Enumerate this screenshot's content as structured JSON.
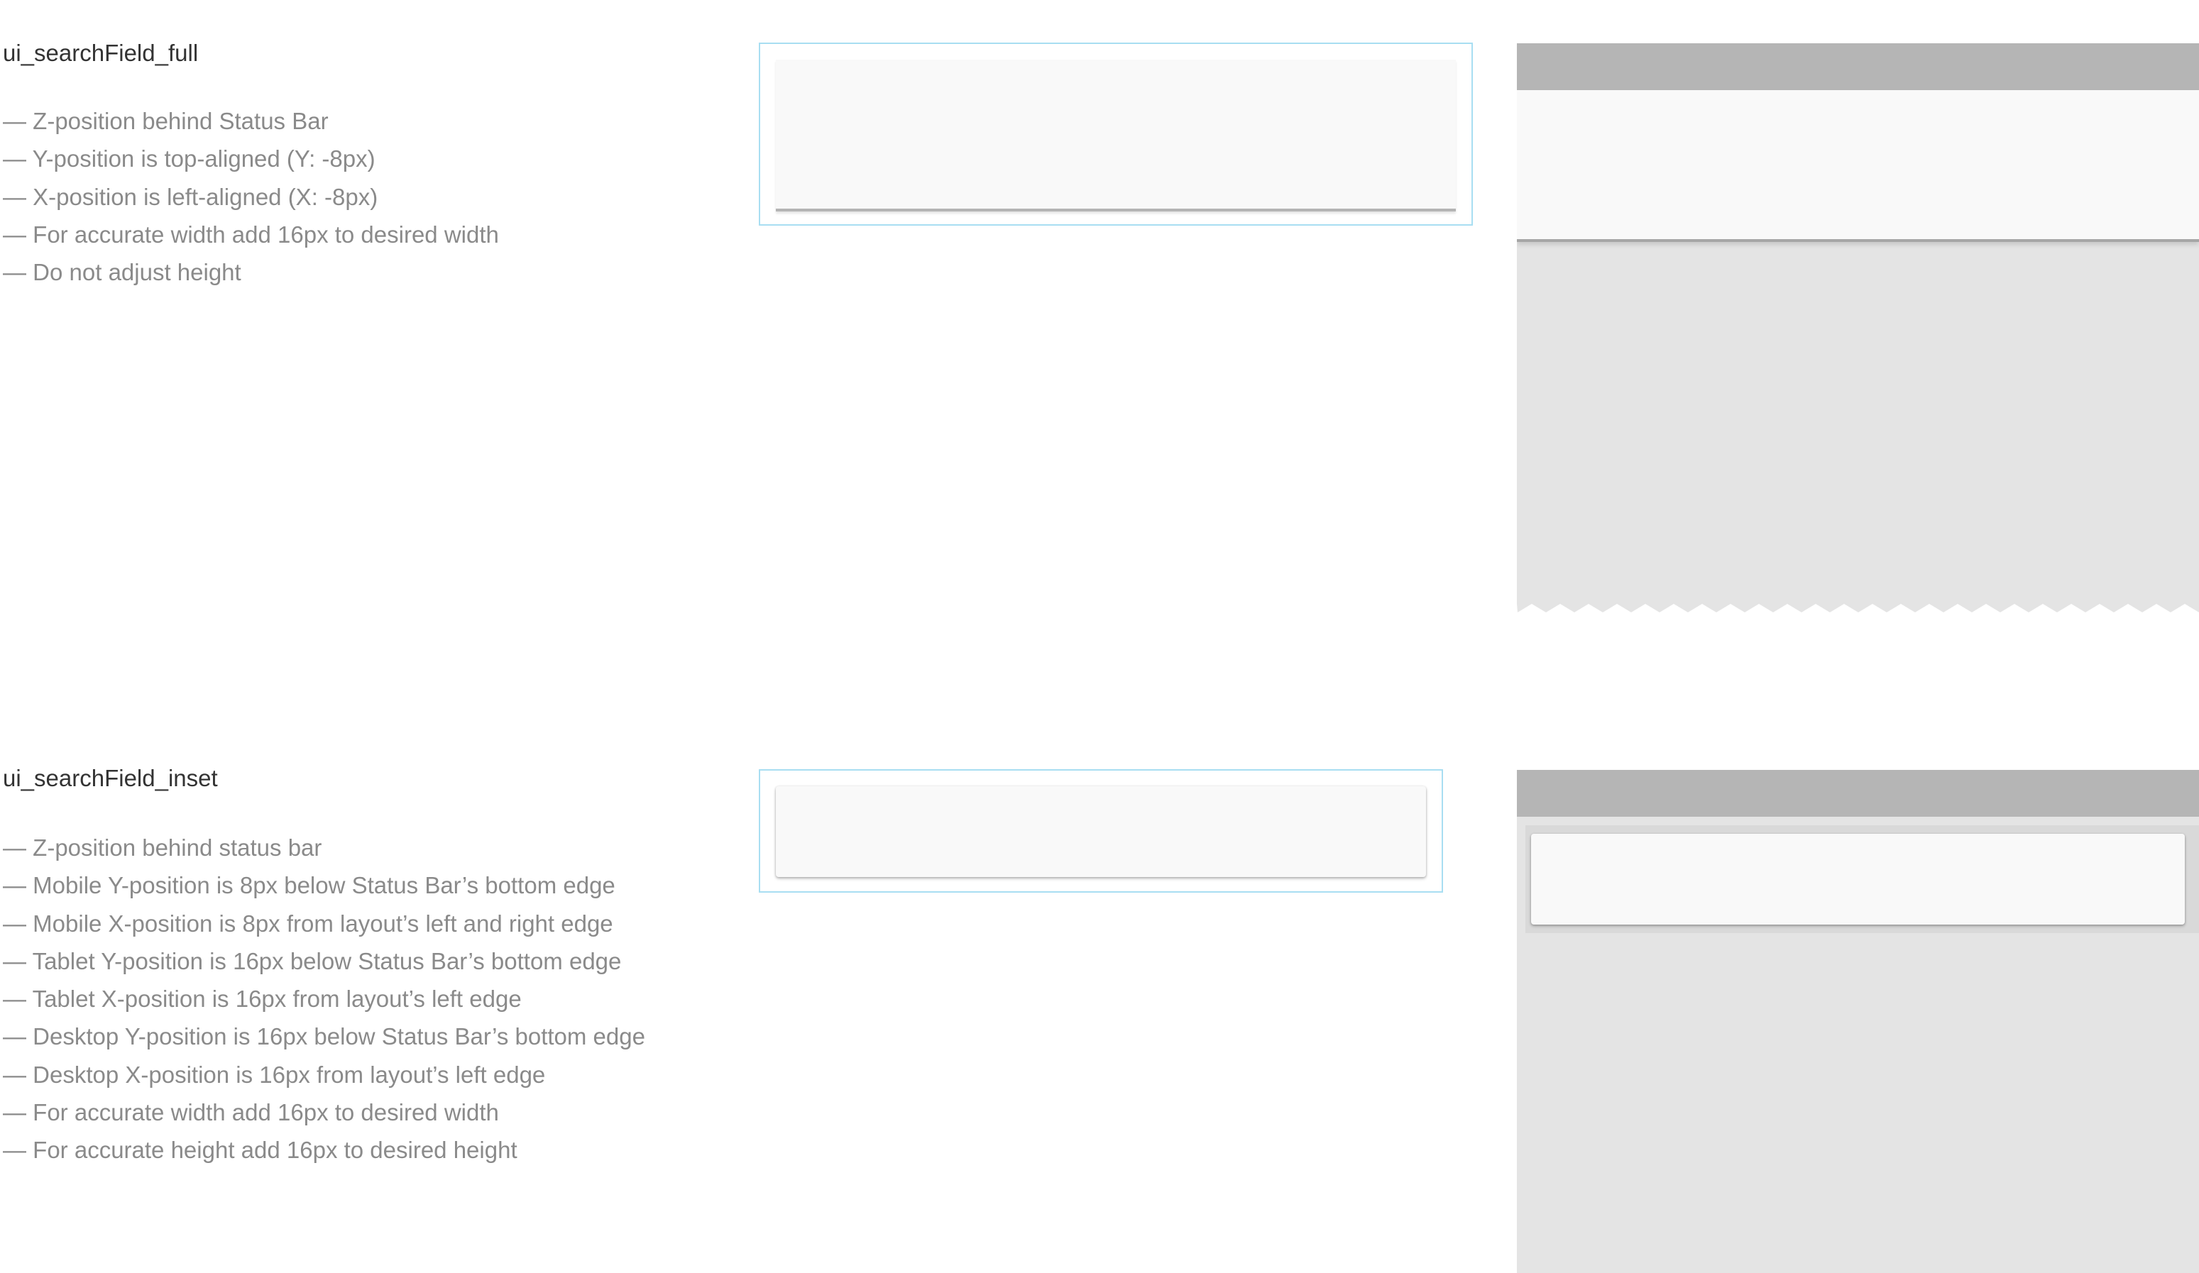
{
  "sections": {
    "full": {
      "title": "ui_searchField_full",
      "notes": [
        "— Z-position behind Status Bar",
        "— Y-position is top-aligned (Y: -8px)",
        "— X-position is left-aligned (X: -8px)",
        "— For accurate width add 16px to desired width",
        "— Do not adjust height"
      ]
    },
    "inset": {
      "title": "ui_searchField_inset",
      "notes": [
        "— Z-position behind status bar",
        "— Mobile Y-position is 8px below Status Bar’s bottom edge",
        "— Mobile X-position is 8px from layout’s left and right edge",
        "— Tablet Y-position is 16px below Status Bar’s bottom edge",
        "— Tablet X-position is 16px from layout’s left edge",
        "— Desktop Y-position is 16px below Status Bar’s bottom edge",
        "— Desktop X-position is 16px from layout’s left edge",
        "— For accurate width add 16px to desired width",
        "— For accurate height add 16px to desired height"
      ]
    }
  },
  "colors": {
    "frame_border": "#a8def2",
    "search_field_fill": "#f9f9f9",
    "status_bar": "#b5b5b5",
    "content_background": "#e4e4e4",
    "title_text": "#333333",
    "note_text": "#8a8a8a"
  }
}
